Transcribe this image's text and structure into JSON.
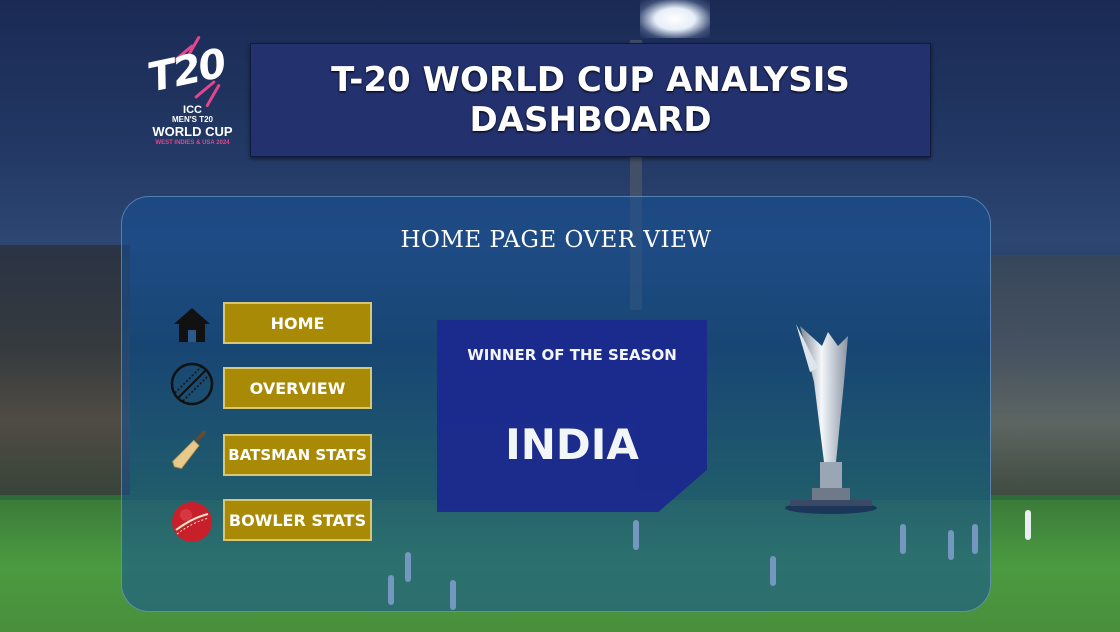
{
  "header": {
    "title_line1": "T-20 WORLD CUP ANALYSIS",
    "title_line2": "DASHBOARD"
  },
  "logo": {
    "mark": "T20",
    "org": "ICC",
    "subtitle": "MEN'S T20",
    "event": "WORLD CUP",
    "hosts": "WEST INDIES & USA 2024"
  },
  "panel": {
    "title": "HOME PAGE OVER VIEW"
  },
  "nav": {
    "home": {
      "label": "HOME",
      "icon": "home-icon"
    },
    "overview": {
      "label": "OVERVIEW",
      "icon": "cricket-ball-outline-icon"
    },
    "batsman": {
      "label": "BATSMAN STATS",
      "icon": "cricket-bat-icon"
    },
    "bowler": {
      "label": "BOWLER STATS",
      "icon": "cricket-ball-icon"
    }
  },
  "winner": {
    "label": "WINNER OF THE SEASON",
    "name": "INDIA"
  },
  "colors": {
    "button": "#a88a07",
    "title_box": "#23316e",
    "winner_box": "#1b2a8f",
    "logo_pink": "#e4458f"
  }
}
